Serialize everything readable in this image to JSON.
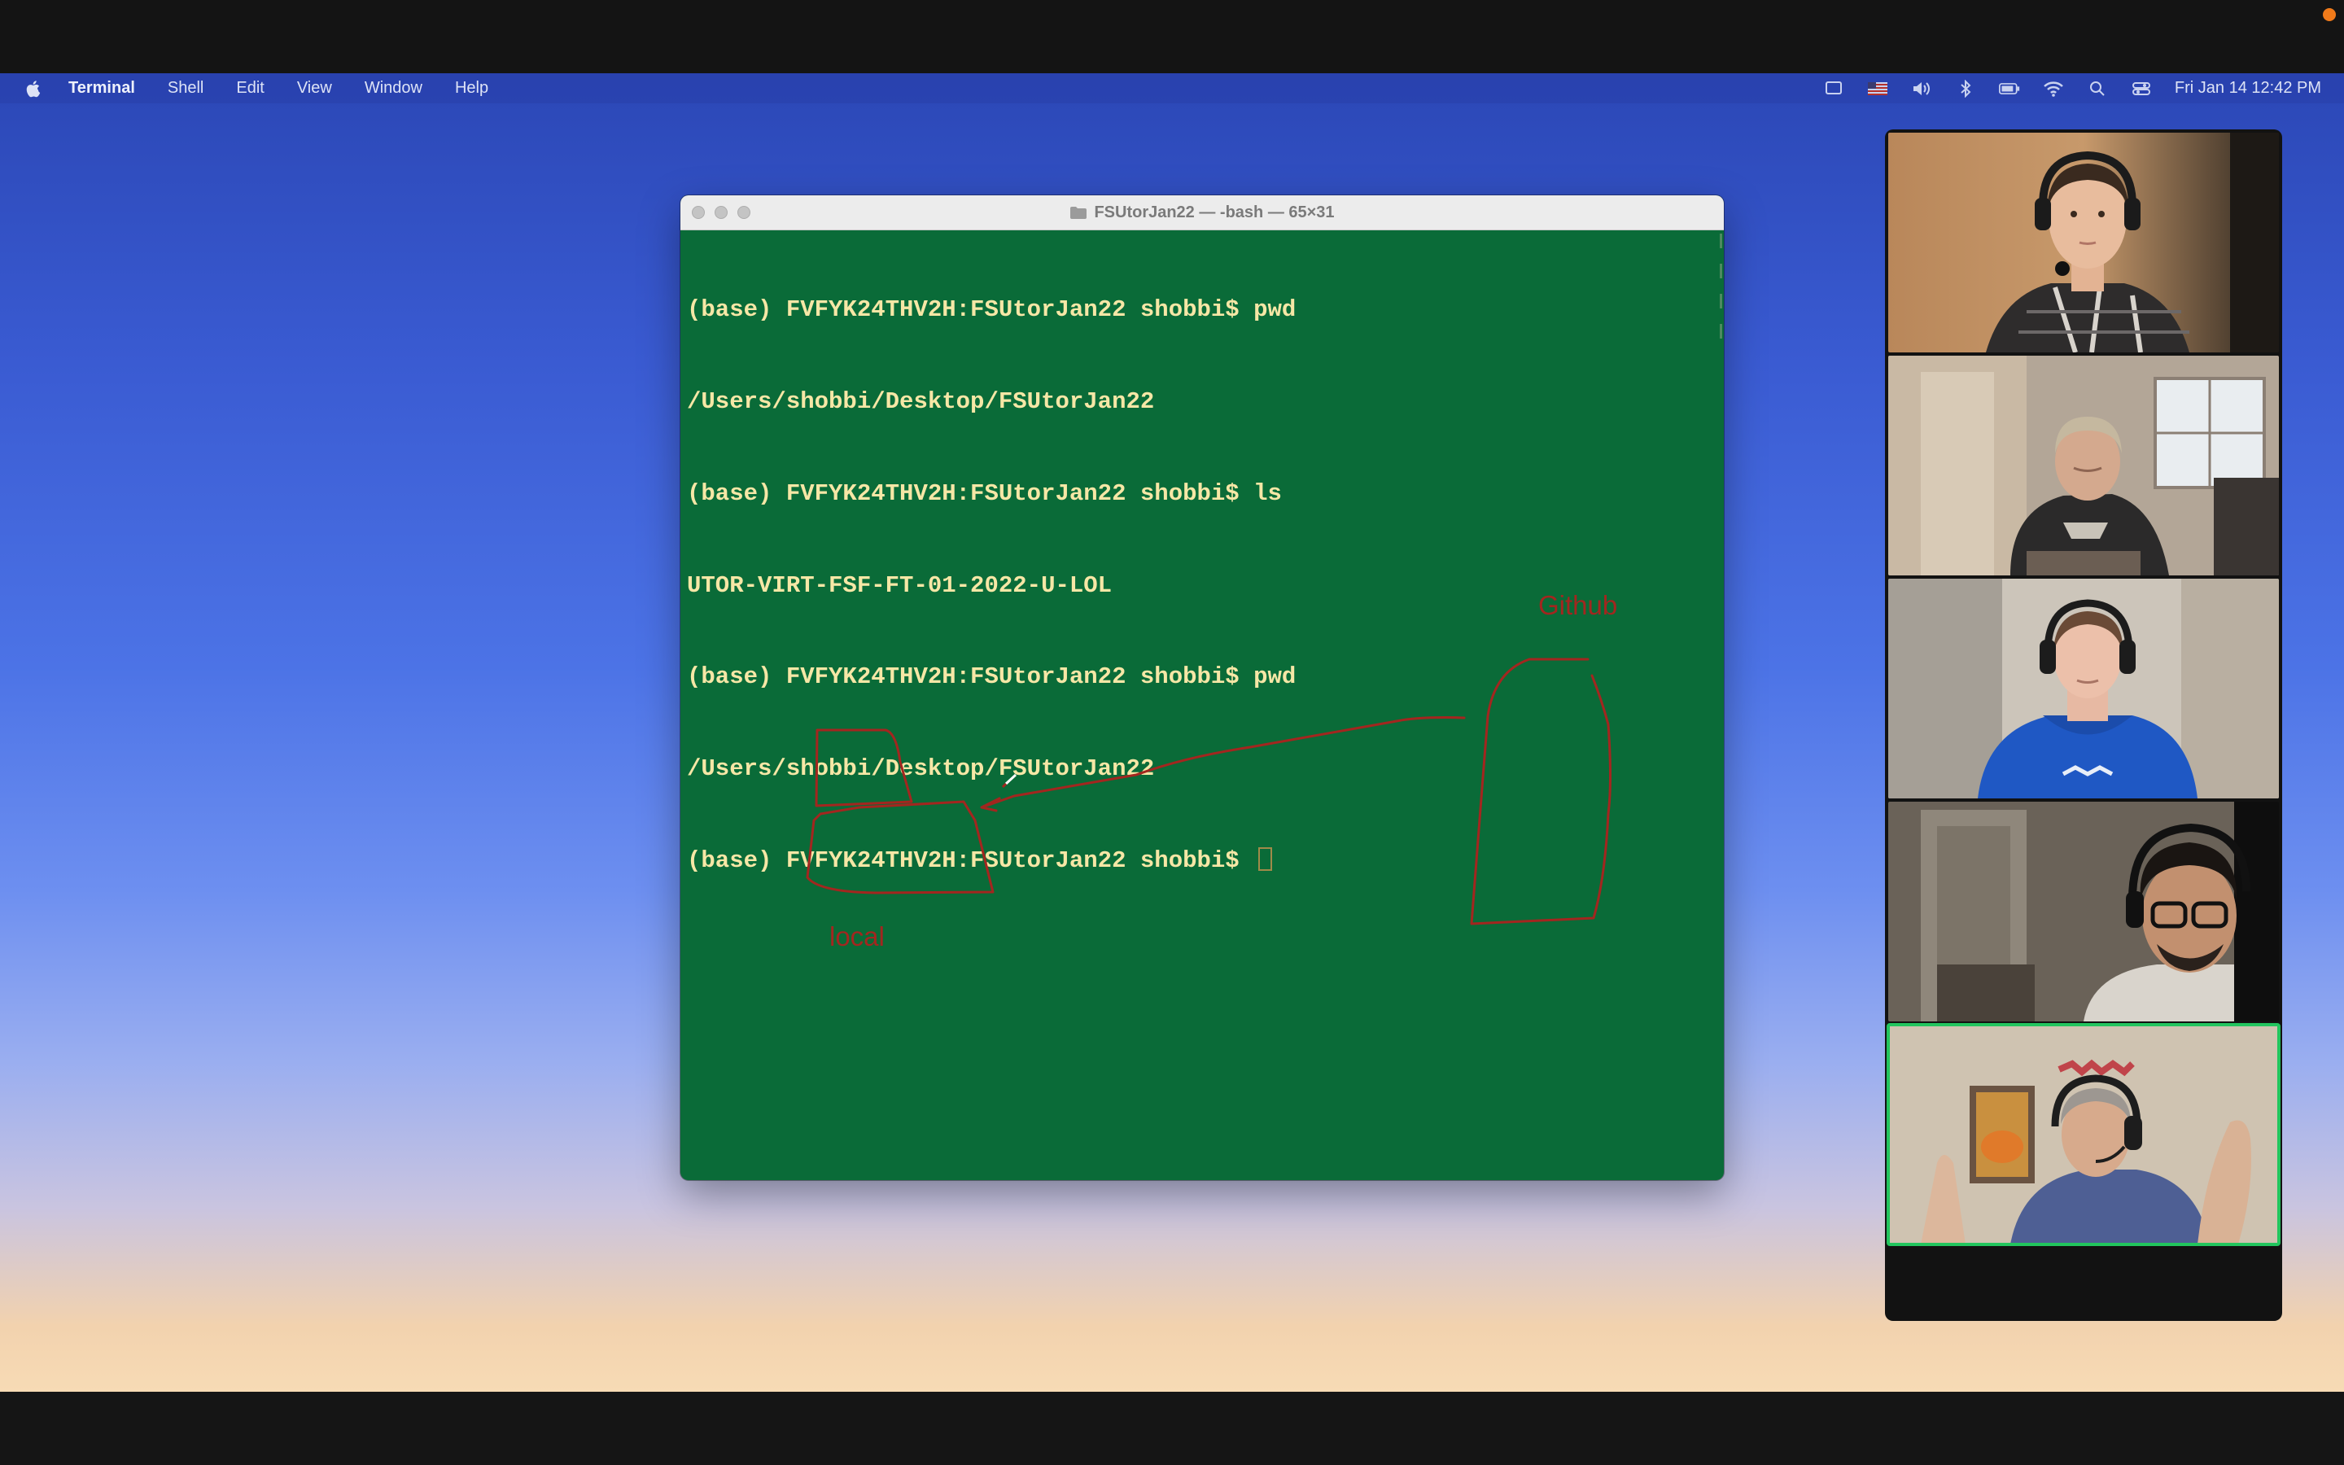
{
  "menubar": {
    "app_name": "Terminal",
    "menus": [
      "Shell",
      "Edit",
      "View",
      "Window",
      "Help"
    ],
    "clock": "Fri Jan 14  12:42 PM",
    "status_icons": [
      "screen-mirror-icon",
      "flag-us-icon",
      "volume-icon",
      "bluetooth-icon",
      "battery-icon",
      "wifi-icon",
      "search-icon",
      "control-center-icon"
    ]
  },
  "terminal": {
    "title": "FSUtorJan22 — -bash — 65×31",
    "lines": [
      "(base) FVFYK24THV2H:FSUtorJan22 shobbi$ pwd",
      "/Users/shobbi/Desktop/FSUtorJan22",
      "(base) FVFYK24THV2H:FSUtorJan22 shobbi$ ls",
      "UTOR-VIRT-FSF-FT-01-2022-U-LOL",
      "(base) FVFYK24THV2H:FSUtorJan22 shobbi$ pwd",
      "/Users/shobbi/Desktop/FSUtorJan22",
      "(base) FVFYK24THV2H:FSUtorJan22 shobbi$ "
    ],
    "colors": {
      "background": "#0a6b38",
      "text": "#f6e7a6",
      "annotation": "#a3261f"
    }
  },
  "annotation": {
    "remote_label": "Github",
    "local_label": "local"
  },
  "participants": {
    "count": 5,
    "active_speaker_index": 4,
    "highlight_color": "#22c55e"
  }
}
